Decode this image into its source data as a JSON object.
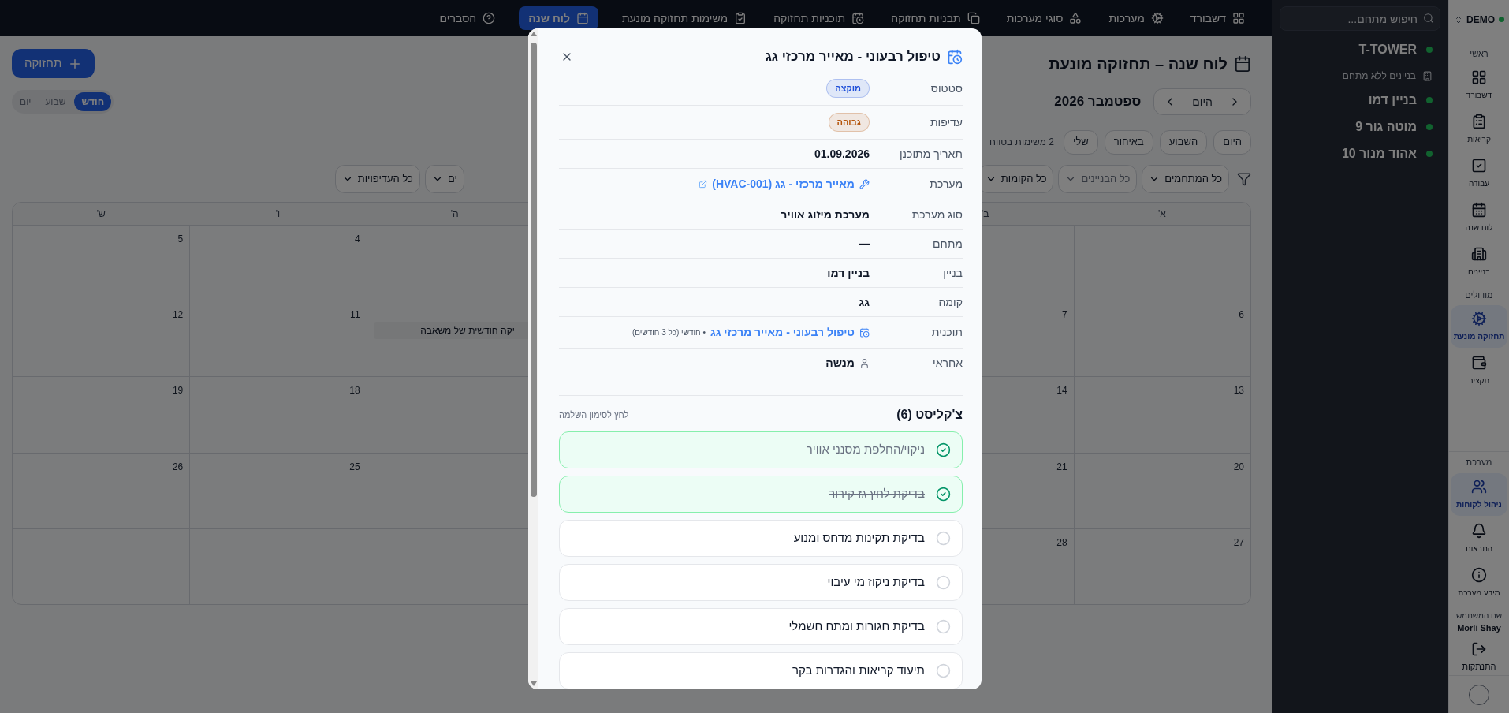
{
  "top_nav": {
    "items": [
      {
        "label": "דשבורד",
        "selected": false
      },
      {
        "label": "מערכות",
        "selected": false
      },
      {
        "label": "סוגי מערכות",
        "selected": false
      },
      {
        "label": "תבניות תחזוקה",
        "selected": false
      },
      {
        "label": "תוכניות תחזוקה",
        "selected": false
      },
      {
        "label": "משימות תחזוקה מונעת",
        "selected": false
      },
      {
        "label": "לוח שנה",
        "selected": true
      },
      {
        "label": "הסברים",
        "selected": false
      }
    ]
  },
  "page": {
    "title": "לוח שנה – תחזוקה מונעת",
    "add_button": "תחזוקה",
    "view_toggle": [
      {
        "label": "חודש",
        "selected": true
      },
      {
        "label": "שבוע",
        "selected": false
      },
      {
        "label": "יום",
        "selected": false
      }
    ],
    "nav": {
      "today": "היום",
      "month": "ספטמבר 2026"
    },
    "quick_filters": [
      {
        "label": "היום",
        "selected": false
      },
      {
        "label": "השבוע",
        "selected": false
      },
      {
        "label": "באיחור",
        "selected": false
      },
      {
        "label": "שלי",
        "selected": false
      }
    ],
    "range_count": "2 משימות בטווח",
    "filters": [
      {
        "label": "כל המתחמים",
        "disabled": false
      },
      {
        "label": "כל הבניינים",
        "disabled": true
      },
      {
        "label": "כל הקומות",
        "disabled": false
      },
      {
        "label": "ים",
        "disabled": false
      },
      {
        "label": "כל העדיפויות",
        "disabled": false
      }
    ]
  },
  "calendar": {
    "weekdays": {
      "col_1": "א'",
      "col_2": "ב'",
      "col_5": "ה'",
      "col_6": "ו'",
      "col_7": "ש'"
    },
    "weeks": [
      {
        "col_6": {
          "day": "4"
        },
        "col_7": {
          "day": "5"
        }
      },
      {
        "col_1": {
          "day": "6"
        },
        "col_2": {
          "day": "7"
        },
        "col_5": {
          "events": [
            "יקה חודשית של משאבה"
          ]
        },
        "col_6": {
          "day": "11"
        },
        "col_7": {
          "day": "12"
        }
      },
      {
        "col_1": {
          "day": "13"
        },
        "col_2": {
          "day": "14"
        },
        "col_6": {
          "day": "18"
        },
        "col_7": {
          "day": "19"
        }
      },
      {
        "col_1": {
          "day": "20"
        },
        "col_2": {
          "day": "21"
        },
        "col_6": {
          "day": "25"
        },
        "col_7": {
          "day": "26"
        }
      },
      {
        "col_1": {
          "day": "27"
        },
        "col_2": {
          "day": "28"
        }
      }
    ]
  },
  "buildings_panel": {
    "search_placeholder": "חיפוש מתחם...",
    "items": [
      {
        "kind": "site",
        "label": "T-TOWER"
      },
      {
        "kind": "header",
        "label": "בניינים ללא מתחם"
      },
      {
        "kind": "building",
        "label": "בניין דמו"
      },
      {
        "kind": "building",
        "label": "מוטה גור 9"
      },
      {
        "kind": "building",
        "label": "אהוד מנור 10"
      }
    ]
  },
  "sidebar": {
    "workspace": "DEMO",
    "sections": [
      {
        "title": "ראשי",
        "items": [
          {
            "label": "דשבורד",
            "selected": false
          },
          {
            "label": "קריאות",
            "selected": false
          },
          {
            "label": "עבודה",
            "selected": false
          },
          {
            "label": "לוח שנה",
            "selected": false
          },
          {
            "label": "בניינים",
            "selected": false
          }
        ]
      },
      {
        "title": "מודולים",
        "items": [
          {
            "label": "תחזוקה מונעת",
            "selected": true
          },
          {
            "label": "תקציב",
            "selected": false
          }
        ]
      },
      {
        "title": "מערכת",
        "items": [
          {
            "label": "ניהול לקוחות",
            "selected": true
          },
          {
            "label": "התראות",
            "selected": false
          },
          {
            "label": "מידע מערכת",
            "selected": false
          }
        ]
      }
    ],
    "user_label": "שם המשתמש",
    "user_name": "Morli Shay",
    "logout": "התנתקות"
  },
  "modal": {
    "title": "טיפול רבעוני - מאייר מרכזי גג",
    "fields": [
      {
        "kind": "badge",
        "label": "סטטוס",
        "value": "מוקצה",
        "color": "#1d4ed8"
      },
      {
        "kind": "badge",
        "label": "עדיפות",
        "value": "גבוהה",
        "color": "#b45309"
      },
      {
        "kind": "text",
        "label": "תאריך מתוכנן",
        "value": "01.09.2026"
      },
      {
        "kind": "system",
        "label": "מערכת",
        "value": "מאייר מרכזי - גג (HVAC-001)"
      },
      {
        "kind": "text",
        "label": "סוג מערכת",
        "value": "מערכת מיזוג אוויר"
      },
      {
        "kind": "text",
        "label": "מתחם",
        "value": "—"
      },
      {
        "kind": "text",
        "label": "בניין",
        "value": "בניין דמו"
      },
      {
        "kind": "text",
        "label": "קומה",
        "value": "גג"
      },
      {
        "kind": "plan",
        "label": "תוכנית",
        "value": "טיפול רבעוני - מאייר מרכזי גג",
        "note": "• חודשי (כל 3 חודשים)"
      },
      {
        "kind": "person",
        "label": "אחראי",
        "value": "מנשה"
      }
    ],
    "checklist": {
      "title": "צ'קליסט (6)",
      "hint": "לחץ לסימון השלמה",
      "items": [
        {
          "label": "ניקוי/החלפת מסנני אוויר",
          "checked": true
        },
        {
          "label": "בדיקת לחץ גז קירור",
          "checked": true
        },
        {
          "label": "בדיקת תקינות מדחס ומנוע",
          "checked": false
        },
        {
          "label": "בדיקת ניקוז מי עיבוי",
          "checked": false
        },
        {
          "label": "בדיקת חגורות ומתח חשמלי",
          "checked": false
        },
        {
          "label": "תיעוד קריאות והגדרות בקר",
          "checked": false
        }
      ]
    }
  }
}
